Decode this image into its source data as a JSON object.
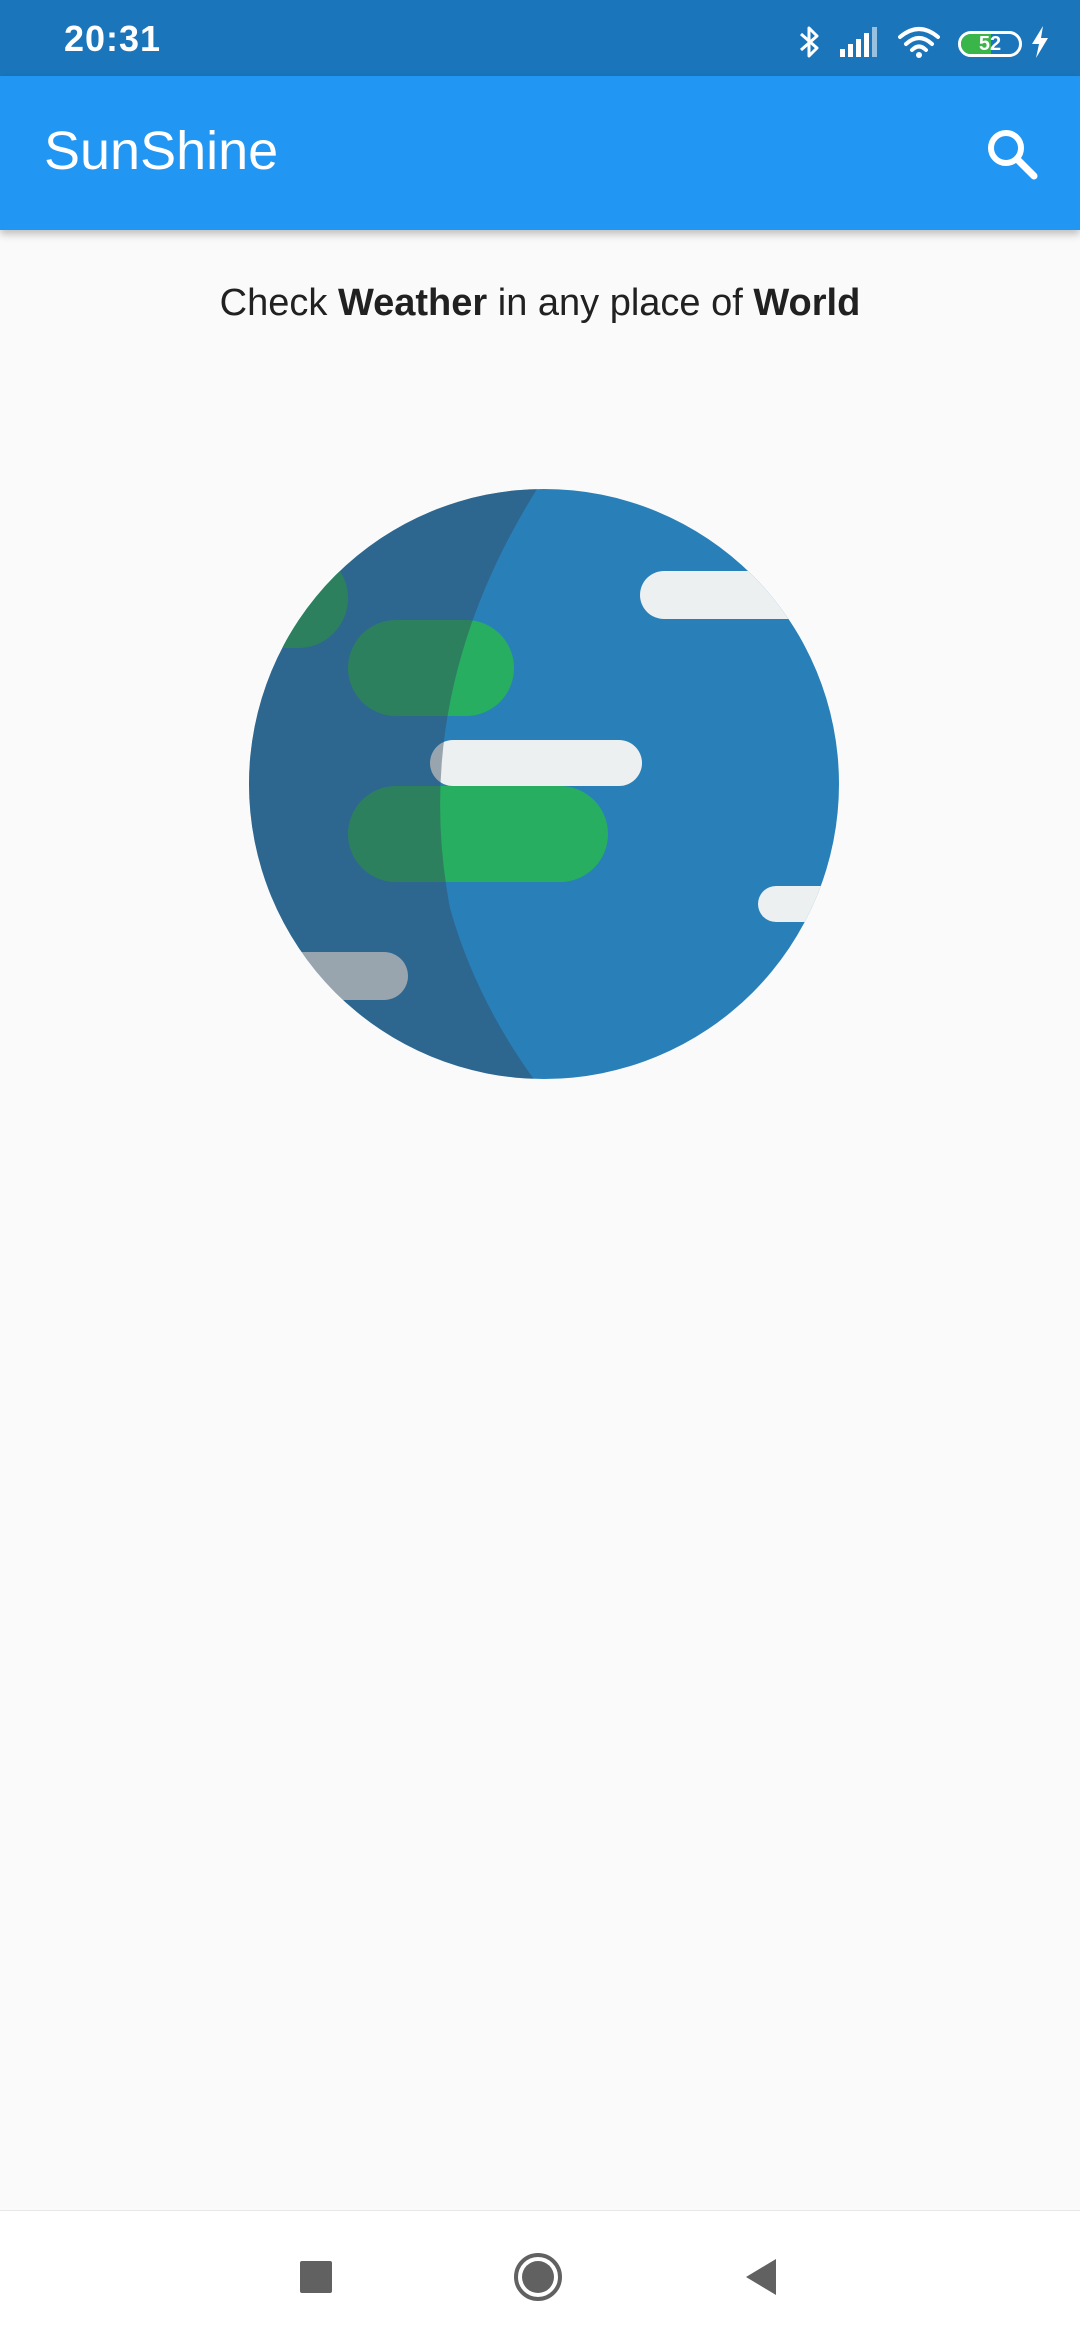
{
  "status_bar": {
    "time": "20:31",
    "battery_level": "52",
    "battery_fraction": 0.52,
    "icons": [
      "bluetooth-icon",
      "signal-icon",
      "wifi-icon",
      "battery-icon",
      "charging-icon"
    ]
  },
  "app_bar": {
    "title": "SunShine",
    "search_icon": "search-icon"
  },
  "main": {
    "tagline": {
      "part1": "Check ",
      "bold1": "Weather",
      "part2": " in any place of ",
      "bold2": "World"
    },
    "illustration": "globe-illustration"
  },
  "nav_bar": {
    "buttons": [
      "recents-square-icon",
      "home-circle-icon",
      "back-triangle-icon"
    ]
  },
  "colors": {
    "status_bar": "#1b75bb",
    "app_bar": "#2196f3",
    "background": "#fafafa",
    "globe_ocean": "#2980b9",
    "globe_land": "#27ae60",
    "cloud": "#ecf0f1"
  }
}
